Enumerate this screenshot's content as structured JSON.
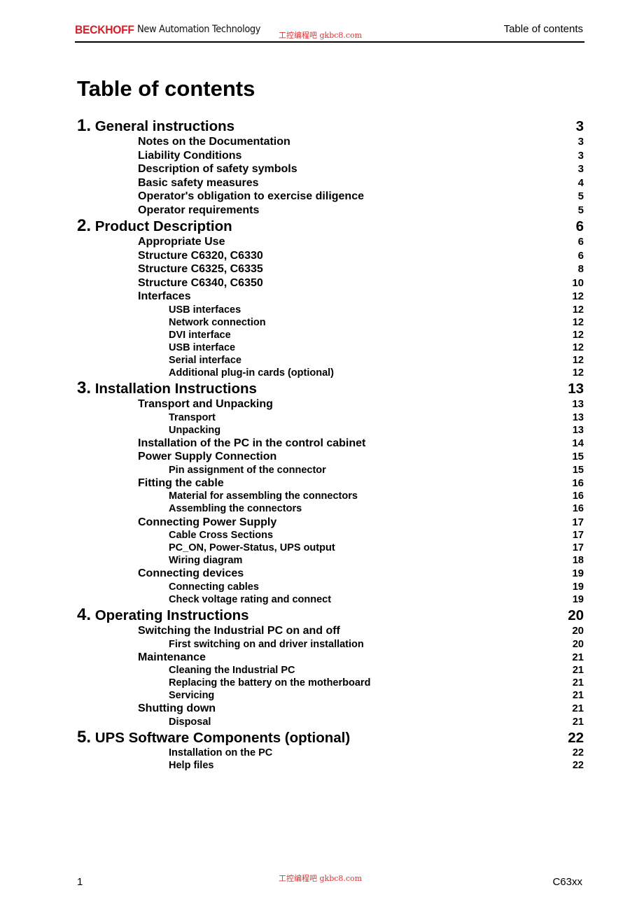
{
  "header": {
    "brand": "BECKHOFF",
    "tagline": "New Automation Technology",
    "watermark": "工控编程吧 gkbc8.com",
    "section_title": "Table of contents"
  },
  "title": "Table of contents",
  "toc": [
    {
      "level": 1,
      "num": "1.",
      "label": "General instructions",
      "page": "3"
    },
    {
      "level": 2,
      "label": "Notes on the Documentation",
      "page": "3"
    },
    {
      "level": 2,
      "label": "Liability Conditions",
      "page": "3"
    },
    {
      "level": 2,
      "label": "Description of safety symbols",
      "page": "3"
    },
    {
      "level": 2,
      "label": "Basic safety measures",
      "page": "4"
    },
    {
      "level": 2,
      "label": "Operator's obligation to exercise diligence",
      "page": "5"
    },
    {
      "level": 2,
      "label": "Operator requirements",
      "page": "5"
    },
    {
      "level": 1,
      "num": "2.",
      "label": "Product Description",
      "page": "6"
    },
    {
      "level": 2,
      "label": "Appropriate Use",
      "page": "6"
    },
    {
      "level": 2,
      "label": "Structure C6320, C6330",
      "page": "6"
    },
    {
      "level": 2,
      "label": "Structure C6325, C6335",
      "page": "8"
    },
    {
      "level": 2,
      "label": "Structure C6340, C6350",
      "page": "10"
    },
    {
      "level": 2,
      "label": "Interfaces",
      "page": "12"
    },
    {
      "level": 3,
      "label": "USB interfaces",
      "page": "12"
    },
    {
      "level": 3,
      "label": "Network connection",
      "page": "12"
    },
    {
      "level": 3,
      "label": "DVI interface",
      "page": "12"
    },
    {
      "level": 3,
      "label": "USB interface",
      "page": "12"
    },
    {
      "level": 3,
      "label": "Serial interface",
      "page": "12"
    },
    {
      "level": 3,
      "label": "Additional plug-in cards (optional)",
      "page": "12"
    },
    {
      "level": 1,
      "num": "3.",
      "label": "Installation Instructions",
      "page": "13"
    },
    {
      "level": 2,
      "label": "Transport and Unpacking",
      "page": "13"
    },
    {
      "level": 3,
      "label": "Transport",
      "page": "13"
    },
    {
      "level": 3,
      "label": "Unpacking",
      "page": "13"
    },
    {
      "level": 2,
      "label": "Installation of the PC in the control cabinet",
      "page": "14"
    },
    {
      "level": 2,
      "label": "Power Supply Connection",
      "page": "15"
    },
    {
      "level": 3,
      "label": "Pin assignment of the connector",
      "page": "15"
    },
    {
      "level": 2,
      "label": "Fitting the cable",
      "page": "16"
    },
    {
      "level": 3,
      "label": "Material for assembling the connectors",
      "page": "16"
    },
    {
      "level": 3,
      "label": "Assembling the connectors",
      "page": "16"
    },
    {
      "level": 2,
      "label": "Connecting Power Supply",
      "page": "17"
    },
    {
      "level": 3,
      "label": "Cable Cross Sections",
      "page": "17"
    },
    {
      "level": 3,
      "label": "PC_ON, Power-Status, UPS output",
      "page": "17"
    },
    {
      "level": 3,
      "label": "Wiring diagram",
      "page": "18"
    },
    {
      "level": 2,
      "label": "Connecting devices",
      "page": "19"
    },
    {
      "level": 3,
      "label": "Connecting cables",
      "page": "19"
    },
    {
      "level": 3,
      "label": "Check voltage rating and connect",
      "page": "19"
    },
    {
      "level": 1,
      "num": "4.",
      "label": "Operating Instructions",
      "page": "20"
    },
    {
      "level": 2,
      "label": "Switching the Industrial PC on and off",
      "page": "20"
    },
    {
      "level": 3,
      "label": "First switching on and driver installation",
      "page": "20"
    },
    {
      "level": 2,
      "label": "Maintenance",
      "page": "21"
    },
    {
      "level": 3,
      "label": "Cleaning the Industrial PC",
      "page": "21"
    },
    {
      "level": 3,
      "label": "Replacing the battery on the motherboard",
      "page": "21"
    },
    {
      "level": 3,
      "label": "Servicing",
      "page": "21"
    },
    {
      "level": 2,
      "label": "Shutting down",
      "page": "21"
    },
    {
      "level": 3,
      "label": "Disposal",
      "page": "21"
    },
    {
      "level": 1,
      "num": "5.",
      "label": "UPS Software Components (optional)",
      "page": "22"
    },
    {
      "level": 3,
      "label": "Installation on the PC",
      "page": "22"
    },
    {
      "level": 3,
      "label": "Help files",
      "page": "22"
    }
  ],
  "footer": {
    "page_number": "1",
    "watermark": "工控编程吧 gkbc8.com",
    "product": "C63xx"
  }
}
